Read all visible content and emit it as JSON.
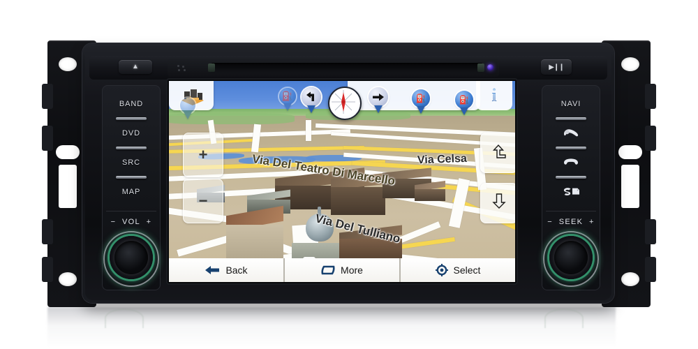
{
  "device": {
    "name": "Car DVD GPS Navigation Head Unit",
    "top_panel": {
      "eject_label": "▲",
      "eject_name": "eject-button",
      "play_pause_label": "▶❙❙",
      "disc_slot_label": "",
      "led_color": "#6e3cff"
    },
    "left_keys": [
      {
        "label": "BAND",
        "name": "band-button"
      },
      {
        "label": "DVD",
        "name": "dvd-button"
      },
      {
        "label": "SRC",
        "name": "src-button"
      },
      {
        "label": "MAP",
        "name": "map-button"
      }
    ],
    "left_knob": {
      "label_minus": "−",
      "label_text": "VOL",
      "label_plus": "+",
      "ring_color": "#46d296"
    },
    "right_keys": [
      {
        "label": "NAVI",
        "icon": "",
        "name": "navi-button"
      },
      {
        "label": "",
        "icon": "phone-answer",
        "name": "phone-answer-button"
      },
      {
        "label": "",
        "icon": "phone-hangup",
        "name": "phone-hangup-button"
      },
      {
        "label": "",
        "icon": "sd-card",
        "name": "sd-card-button"
      }
    ],
    "right_knob": {
      "label_minus": "−",
      "label_text": "SEEK",
      "label_plus": "+",
      "ring_color": "#46d296"
    }
  },
  "screen": {
    "app": "3D Navigation Map",
    "toolbar": {
      "city3d_icon": "3d-buildings-icon",
      "items": [
        {
          "name": "poi-3d-city",
          "icon": "3d-buildings-icon",
          "glyph": ""
        },
        {
          "name": "poi-marker-1",
          "icon": "map-pin-icon",
          "glyph": "⛽"
        },
        {
          "name": "turn-left-marker",
          "icon": "turn-left-icon",
          "glyph": "↰"
        },
        {
          "name": "compass",
          "icon": "compass-icon",
          "glyph": ""
        },
        {
          "name": "turn-right-marker",
          "icon": "turn-right-icon",
          "glyph": "➜"
        },
        {
          "name": "poi-fuel-1",
          "icon": "fuel-pin-icon",
          "glyph": "⛽"
        },
        {
          "name": "poi-fuel-2",
          "icon": "fuel-pin-icon",
          "glyph": "⛽"
        }
      ],
      "info_label": "i",
      "info_name": "info-button"
    },
    "zoom_controls": {
      "zoom_in_label": "+",
      "zoom_out_label": "−"
    },
    "tilt_controls": {
      "up_label": "↱",
      "down_label": "↧"
    },
    "street_labels": [
      {
        "text": "Via Del Teatro Di Marcello",
        "name": "street-label-teatro-di-marcello"
      },
      {
        "text": "Via Celsa",
        "name": "street-label-via-celsa"
      },
      {
        "text": "Via Del Tulliano",
        "name": "street-label-via-del-tulliano"
      }
    ],
    "bottom_buttons": [
      {
        "label": "Back",
        "icon": "back-arrow-icon",
        "glyph": "⬅",
        "name": "back-button"
      },
      {
        "label": "More",
        "icon": "more-icon",
        "glyph": "⬜",
        "name": "more-button"
      },
      {
        "label": "Select",
        "icon": "crosshair-icon",
        "glyph": "⭗",
        "name": "select-button"
      }
    ],
    "colors": {
      "sky": "#4b7fd4",
      "ground": "#c4b695",
      "major_road": "#f6d651",
      "minor_road": "#fdfdfa",
      "water": "#5b8fd6",
      "green": "#8cbd74",
      "button_bar": "#ffffff",
      "accent_blue": "#17416f"
    }
  }
}
